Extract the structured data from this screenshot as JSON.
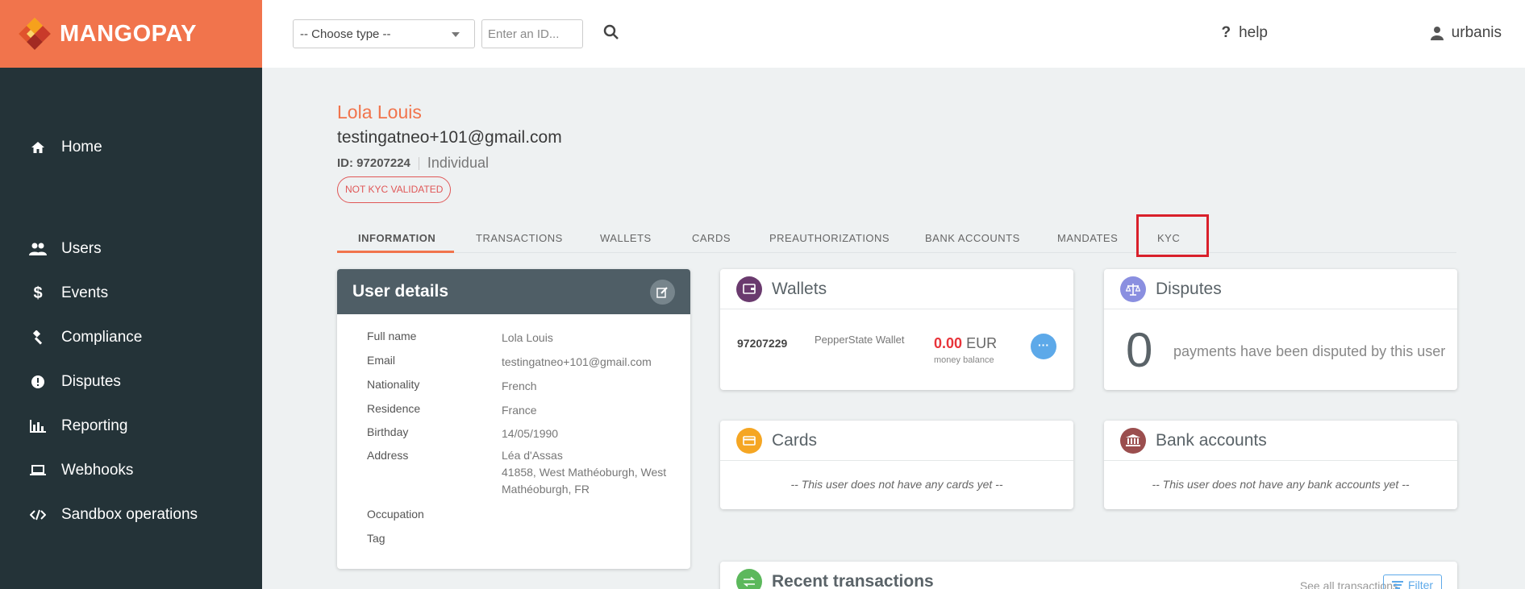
{
  "app": {
    "brand": "MANGOPAY",
    "accent": "#f1744c"
  },
  "sidebar": {
    "items": [
      {
        "label": "Home",
        "icon": "home-icon"
      },
      {
        "label": "Users",
        "icon": "users-icon"
      },
      {
        "label": "Events",
        "icon": "dollar-icon"
      },
      {
        "label": "Compliance",
        "icon": "gavel-icon"
      },
      {
        "label": "Disputes",
        "icon": "alert-icon"
      },
      {
        "label": "Reporting",
        "icon": "bar-chart-icon"
      },
      {
        "label": "Webhooks",
        "icon": "laptop-icon"
      },
      {
        "label": "Sandbox operations",
        "icon": "code-icon"
      }
    ]
  },
  "topbar": {
    "type_select": "-- Choose type --",
    "id_placeholder": "Enter an ID...",
    "help": "help",
    "username": "urbanis"
  },
  "user": {
    "name": "Lola Louis",
    "email": "testingatneo+101@gmail.com",
    "id_label": "ID: 97207224",
    "type": "Individual",
    "kyc_badge": "NOT KYC VALIDATED"
  },
  "tabs": [
    "INFORMATION",
    "TRANSACTIONS",
    "WALLETS",
    "CARDS",
    "PREAUTHORIZATIONS",
    "BANK ACCOUNTS",
    "MANDATES",
    "KYC"
  ],
  "user_details": {
    "title": "User details",
    "rows": [
      {
        "key": "Full name",
        "value": "Lola Louis"
      },
      {
        "key": "Email",
        "value": "testingatneo+101@gmail.com"
      },
      {
        "key": "Nationality",
        "value": "French"
      },
      {
        "key": "Residence",
        "value": "France"
      },
      {
        "key": "Birthday",
        "value": "14/05/1990"
      },
      {
        "key": "Address",
        "value": "Léa d'Assas\n41858, West Mathéoburgh, West Mathéoburgh, FR"
      },
      {
        "key": "Occupation",
        "value": ""
      },
      {
        "key": "Tag",
        "value": ""
      }
    ]
  },
  "wallets": {
    "title": "Wallets",
    "id": "97207229",
    "name": "PepperState Wallet",
    "amount": "0.00",
    "currency": "EUR",
    "sub": "money balance"
  },
  "disputes": {
    "title": "Disputes",
    "count": "0",
    "text": "payments have been disputed by this user"
  },
  "cards": {
    "title": "Cards",
    "empty": "-- This user does not have any cards yet --"
  },
  "bank_accounts": {
    "title": "Bank accounts",
    "empty": "-- This user does not have any bank accounts yet --"
  },
  "recent": {
    "title": "Recent transactions",
    "see_all": "See all transactions",
    "filter": "Filter"
  }
}
